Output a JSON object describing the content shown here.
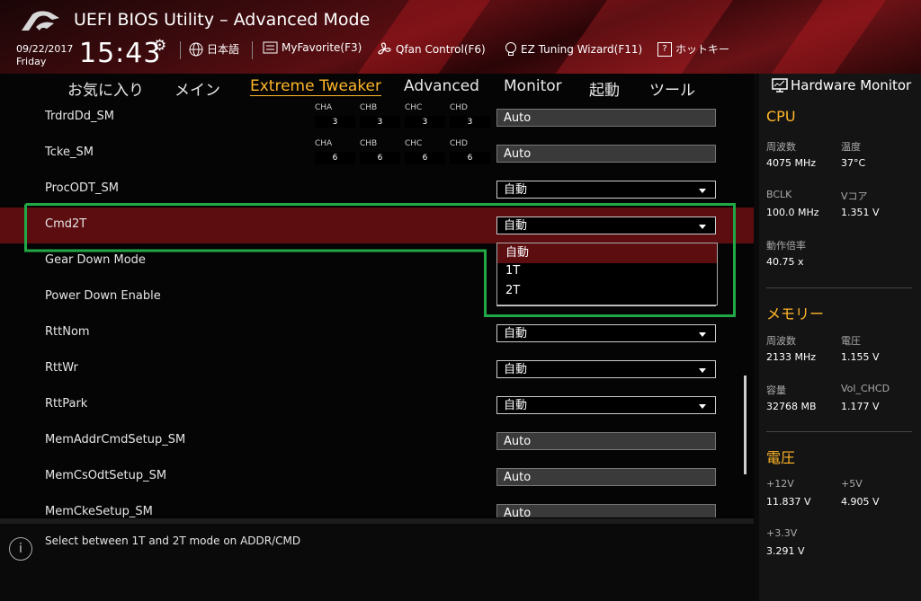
{
  "header": {
    "title": "UEFI BIOS Utility – Advanced Mode",
    "date": "09/22/2017",
    "day": "Friday",
    "time": "15:43",
    "toolbar": {
      "language": "日本語",
      "myfavorite": "MyFavorite(F3)",
      "qfan": "Qfan Control(F6)",
      "ez_tuning": "EZ Tuning Wizard(F11)",
      "hotkeys": "ホットキー"
    }
  },
  "nav": {
    "tabs": [
      "お気に入り",
      "メイン",
      "Extreme Tweaker",
      "Advanced",
      "Monitor",
      "起動",
      "ツール"
    ],
    "active": "Extreme Tweaker"
  },
  "settings": {
    "rows": [
      {
        "label": "TrdrdDd_SM",
        "channels": [
          {
            "name": "CHA",
            "value": "3"
          },
          {
            "name": "CHB",
            "value": "3"
          },
          {
            "name": "CHC",
            "value": "3"
          },
          {
            "name": "CHD",
            "value": "3"
          }
        ],
        "value": "Auto"
      },
      {
        "label": "Tcke_SM",
        "channels": [
          {
            "name": "CHA",
            "value": "6"
          },
          {
            "name": "CHB",
            "value": "6"
          },
          {
            "name": "CHC",
            "value": "6"
          },
          {
            "name": "CHD",
            "value": "6"
          }
        ],
        "value": "Auto"
      },
      {
        "label": "ProcODT_SM",
        "value": "自動"
      },
      {
        "label": "Cmd2T",
        "value": "自動"
      },
      {
        "label": "Gear Down Mode"
      },
      {
        "label": "Power Down Enable"
      },
      {
        "label": "RttNom",
        "value": "自動"
      },
      {
        "label": "RttWr",
        "value": "自動"
      },
      {
        "label": "RttPark",
        "value": "自動"
      },
      {
        "label": "MemAddrCmdSetup_SM",
        "value": "Auto"
      },
      {
        "label": "MemCsOdtSetup_SM",
        "value": "Auto"
      },
      {
        "label": "MemCkeSetup_SM",
        "value": "Auto"
      }
    ],
    "dropdown_options": [
      "自動",
      "1T",
      "2T"
    ],
    "dropdown_selected": "自動"
  },
  "help_text": "Select between 1T and 2T mode on ADDR/CMD",
  "hardware_monitor": {
    "title": "Hardware Monitor",
    "cpu": {
      "title": "CPU",
      "freq_label": "周波数",
      "freq": "4075 MHz",
      "temp_label": "温度",
      "temp": "37°C",
      "bclk_label": "BCLK",
      "bclk": "100.0 MHz",
      "vcore_label": "Vコア",
      "vcore": "1.351 V",
      "ratio_label": "動作倍率",
      "ratio": "40.75 x"
    },
    "memory": {
      "title": "メモリー",
      "freq_label": "周波数",
      "freq": "2133 MHz",
      "volt_label": "電圧",
      "volt": "1.155 V",
      "cap_label": "容量",
      "cap": "32768 MB",
      "vol_chcd_label": "Vol_CHCD",
      "vol_chcd": "1.177 V"
    },
    "voltage": {
      "title": "電圧",
      "v12_label": "+12V",
      "v12": "11.837 V",
      "v5_label": "+5V",
      "v5": "4.905 V",
      "v33_label": "+3.3V",
      "v33": "3.291 V"
    }
  },
  "colors": {
    "accent": "#ffb62a",
    "selected_row": "#5c0d10",
    "highlight_box": "#22a846"
  }
}
